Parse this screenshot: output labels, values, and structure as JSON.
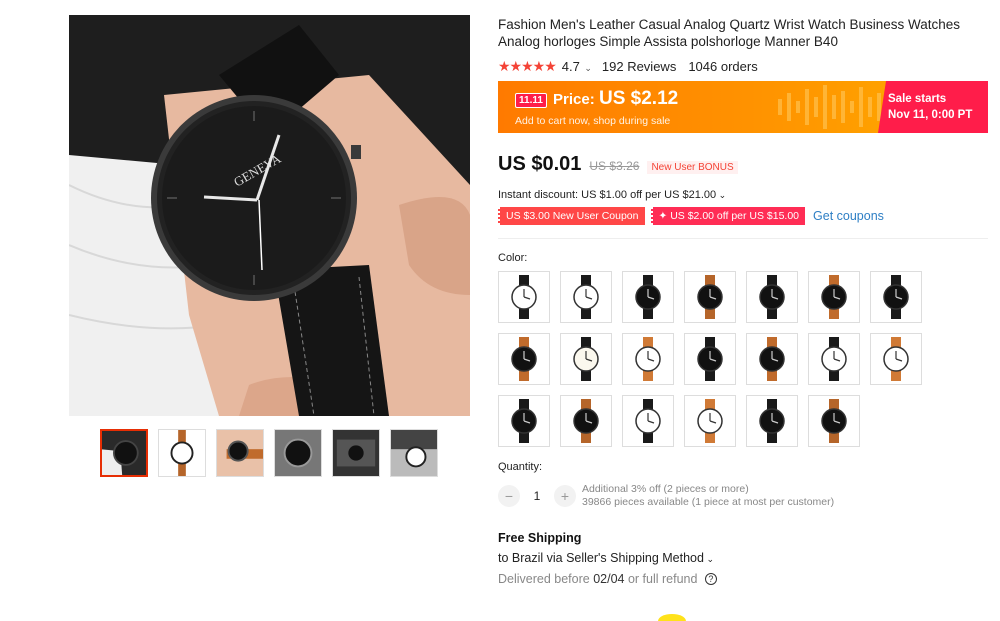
{
  "product": {
    "title": "Fashion Men's Leather Casual Analog Quartz Wrist Watch Business Watches Analog horloges Simple Assista polshorloge Manner B40",
    "dial_brand": "GENEVA",
    "rating": "4.7",
    "reviews": "192 Reviews",
    "orders": "1046 orders"
  },
  "banner": {
    "badge": "11.11",
    "price_label": "Price:",
    "price": "US $2.12",
    "subtitle": "Add to cart now, shop during sale",
    "sale_line1": "Sale starts",
    "sale_line2": "Nov 11, 0:00 PT"
  },
  "pricing": {
    "price": "US $0.01",
    "old_price": "US $3.26",
    "bonus": "New User BONUS",
    "instant_discount": "Instant discount: US $1.00 off per US $21.00",
    "coupon1": "US $3.00 New User Coupon",
    "coupon2": "✦ US $2.00 off per US $15.00",
    "get_coupons": "Get coupons"
  },
  "color": {
    "label": "Color:",
    "swatches": [
      {
        "strap": "#1a1a1a",
        "face": "#ffffff"
      },
      {
        "strap": "#1a1a1a",
        "face": "#ffffff"
      },
      {
        "strap": "#1a1a1a",
        "face": "#111111"
      },
      {
        "strap": "#b5652a",
        "face": "#111111"
      },
      {
        "strap": "#1a1a1a",
        "face": "#111111"
      },
      {
        "strap": "#c06b2c",
        "face": "#111111"
      },
      {
        "strap": "#1a1a1a",
        "face": "#111111"
      },
      {
        "strap": "#c06b2c",
        "face": "#111111"
      },
      {
        "strap": "#1a1a1a",
        "face": "#fbf8ee"
      },
      {
        "strap": "#d07a36",
        "face": "#ffffff"
      },
      {
        "strap": "#1a1a1a",
        "face": "#111111"
      },
      {
        "strap": "#c06b2c",
        "face": "#111111"
      },
      {
        "strap": "#1a1a1a",
        "face": "#ffffff"
      },
      {
        "strap": "#d07a36",
        "face": "#ffffff"
      },
      {
        "strap": "#1a1a1a",
        "face": "#111111"
      },
      {
        "strap": "#b5652a",
        "face": "#111111"
      },
      {
        "strap": "#1a1a1a",
        "face": "#ffffff"
      },
      {
        "strap": "#d07a36",
        "face": "#ffffff"
      },
      {
        "strap": "#1a1a1a",
        "face": "#111111"
      },
      {
        "strap": "#b5652a",
        "face": "#111111"
      }
    ]
  },
  "quantity": {
    "label": "Quantity:",
    "value": "1",
    "minus": "−",
    "plus": "+",
    "info1": "Additional 3% off (2 pieces or more)",
    "info2": "39866 pieces available (1 piece at most per customer)"
  },
  "shipping": {
    "title": "Free Shipping",
    "to": "to Brazil via Seller's Shipping Method",
    "delivered_prefix": "Delivered before",
    "delivered_date": "02/04",
    "delivered_suffix": "or full refund"
  },
  "colors": {
    "accent": "#e62e04",
    "star": "#f44336",
    "banner": "#ff9b00",
    "sale": "#ff1d4a",
    "link": "#2e7fc5"
  }
}
